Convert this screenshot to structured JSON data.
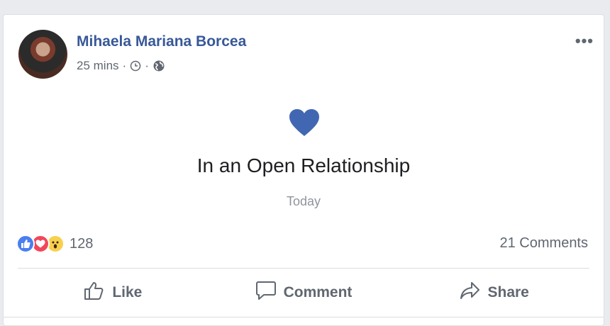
{
  "post": {
    "author": "Mihaela Mariana Borcea",
    "time": "25 mins",
    "separator": "·",
    "more_label": "•••",
    "event_title": "In an Open Relationship",
    "event_date": "Today"
  },
  "stats": {
    "reaction_count": "128",
    "comments": "21 Comments",
    "reactions": [
      "like-reaction-icon",
      "love-reaction-icon",
      "wow-reaction-icon"
    ]
  },
  "actions": {
    "like": "Like",
    "comment": "Comment",
    "share": "Share"
  },
  "colors": {
    "name": "#385898",
    "heart": "#4267b2",
    "like": "#4a7ff0",
    "love": "#f2475a",
    "wow": "#f7d04c"
  }
}
